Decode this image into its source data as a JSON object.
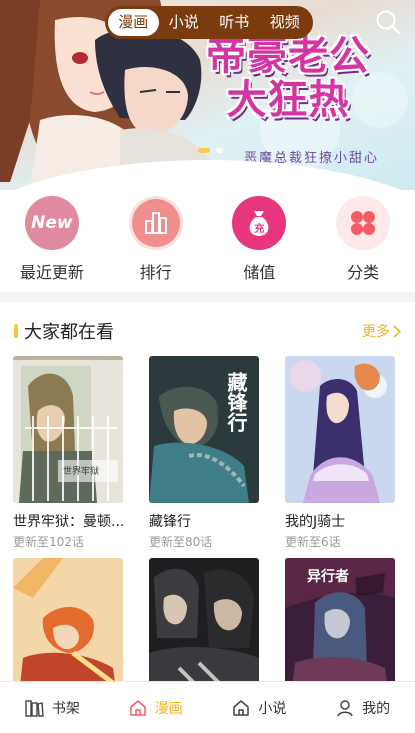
{
  "banner": {
    "title": "帝豪老公大狂热",
    "subtitle": "恶魔总裁狂撩小甜心",
    "slide_count": 2,
    "active_slide": 1
  },
  "top_tabs": [
    {
      "label": "漫画",
      "active": true
    },
    {
      "label": "小说",
      "active": false
    },
    {
      "label": "听书",
      "active": false
    },
    {
      "label": "视频",
      "active": false
    }
  ],
  "quick_nav": [
    {
      "label": "最近更新",
      "icon": "new-icon",
      "badge_text": "New",
      "color": "#e08aa0"
    },
    {
      "label": "排行",
      "icon": "chart-icon",
      "color": "#f08e8e"
    },
    {
      "label": "储值",
      "icon": "money-bag-icon",
      "badge_text": "充",
      "color": "#e8367e"
    },
    {
      "label": "分类",
      "icon": "category-icon",
      "color": "#f35c66"
    }
  ],
  "section": {
    "title": "大家都在看",
    "more_label": "更多"
  },
  "comics": [
    {
      "title": "世界牢狱：曼顿...",
      "update": "更新至102话",
      "cover_text": "世界牢狱"
    },
    {
      "title": "藏锋行",
      "update": "更新至80话",
      "cover_text": "藏锋行"
    },
    {
      "title": "我的J骑士",
      "update": "更新至6话",
      "cover_text": ""
    },
    {
      "title": "",
      "update": "",
      "cover_text": ""
    },
    {
      "title": "",
      "update": "",
      "cover_text": ""
    },
    {
      "title": "",
      "update": "",
      "cover_text": "异行者"
    }
  ],
  "bottom_nav": [
    {
      "label": "书架",
      "icon": "bookshelf-icon",
      "active": false
    },
    {
      "label": "漫画",
      "icon": "home-icon",
      "active": true
    },
    {
      "label": "小说",
      "icon": "home-icon",
      "active": false
    },
    {
      "label": "我的",
      "icon": "user-icon",
      "active": false
    }
  ],
  "colors": {
    "accent": "#f0b322",
    "tab_bar": "#7a3b0f",
    "banner_title": "#d534a3"
  }
}
